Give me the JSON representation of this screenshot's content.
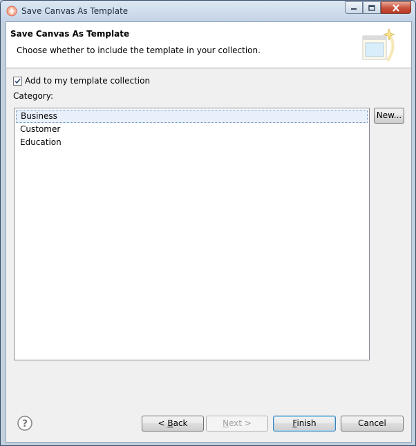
{
  "window": {
    "title": "Save Canvas As Template",
    "minimize_icon": "minimize-icon",
    "maximize_icon": "maximize-icon",
    "close_icon": "close-icon"
  },
  "banner": {
    "title": "Save Canvas As Template",
    "description": "Choose whether to include the template in your collection.",
    "image": "wizard-banner-icon"
  },
  "form": {
    "checkbox_label": "Add to my template collection",
    "checkbox_checked": true,
    "category_label": "Category:",
    "categories": [
      "Business",
      "Customer",
      "Education"
    ],
    "selected_category": "Business",
    "new_button": "New..."
  },
  "footer": {
    "help_icon": "help-icon",
    "back": {
      "prefix": "< ",
      "mnemonic": "B",
      "rest": "ack"
    },
    "next": {
      "mnemonic": "N",
      "rest": "ext >"
    },
    "finish": {
      "mnemonic": "F",
      "rest": "inish"
    },
    "cancel": "Cancel"
  }
}
